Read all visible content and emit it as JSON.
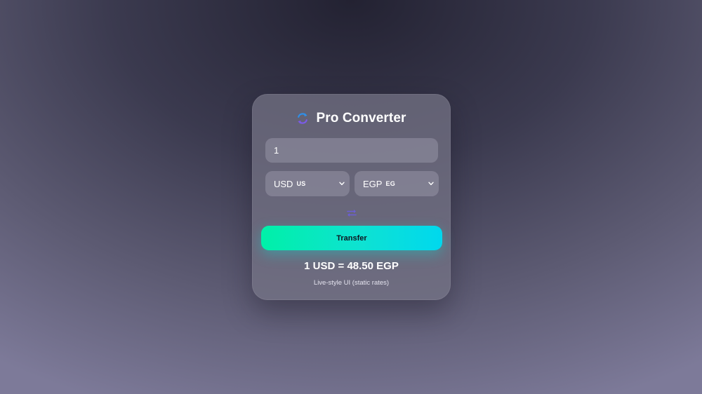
{
  "header": {
    "title": "Pro Converter",
    "logo_icon": "rotate-arrows-icon"
  },
  "amount_input": {
    "value": "1",
    "placeholder": ""
  },
  "from_currency": {
    "code": "USD",
    "flag": "US"
  },
  "to_currency": {
    "code": "EGP",
    "flag": "EG"
  },
  "swap_icon": "swap-arrows-icon",
  "transfer_button": {
    "label": "Transfer"
  },
  "result": {
    "text": "1 USD = 48.50 EGP"
  },
  "note": {
    "text": "Live-style UI (static rates)"
  },
  "colors": {
    "accent_start": "#00f0a8",
    "accent_end": "#00d8ee",
    "logo_blue": "#2f8fe8",
    "logo_purple": "#7b5be6"
  }
}
